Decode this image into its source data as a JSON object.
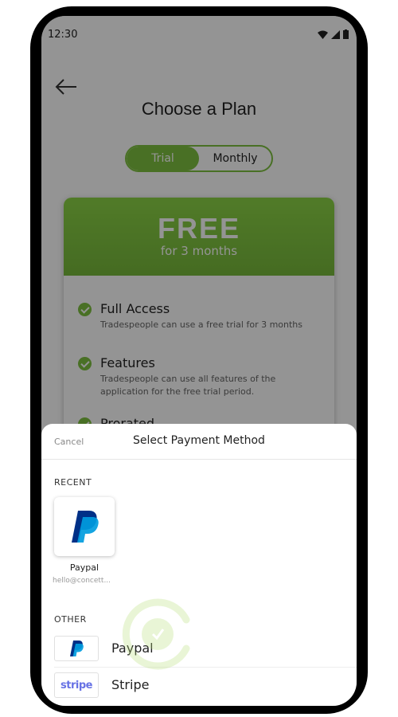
{
  "status_bar": {
    "time": "12:30"
  },
  "page": {
    "title": "Choose a Plan"
  },
  "plan_toggle": {
    "options": [
      "Trial",
      "Monthly"
    ],
    "active": "Trial"
  },
  "plan": {
    "price": "FREE",
    "duration": "for 3 months",
    "features": [
      {
        "title": "Full Access",
        "description": "Tradespeople can use a free trial for 3 months"
      },
      {
        "title": "Features",
        "description": "Tradespeople can use all features of the application for the free trial period."
      },
      {
        "title": "Prorated",
        "description": ""
      }
    ]
  },
  "payment_sheet": {
    "cancel_label": "Cancel",
    "title": "Select Payment Method",
    "recent_label": "RECENT",
    "recent": {
      "name": "Paypal",
      "email": "hello@concett..."
    },
    "other_label": "OTHER",
    "other_methods": [
      {
        "name": "Paypal",
        "icon": "paypal-logo"
      },
      {
        "name": "Stripe",
        "icon": "stripe-logo",
        "logo_text": "stripe"
      }
    ]
  },
  "colors": {
    "accent": "#7fc240",
    "paypal_dark": "#003087",
    "paypal_light": "#009cde",
    "stripe": "#6772e5"
  }
}
